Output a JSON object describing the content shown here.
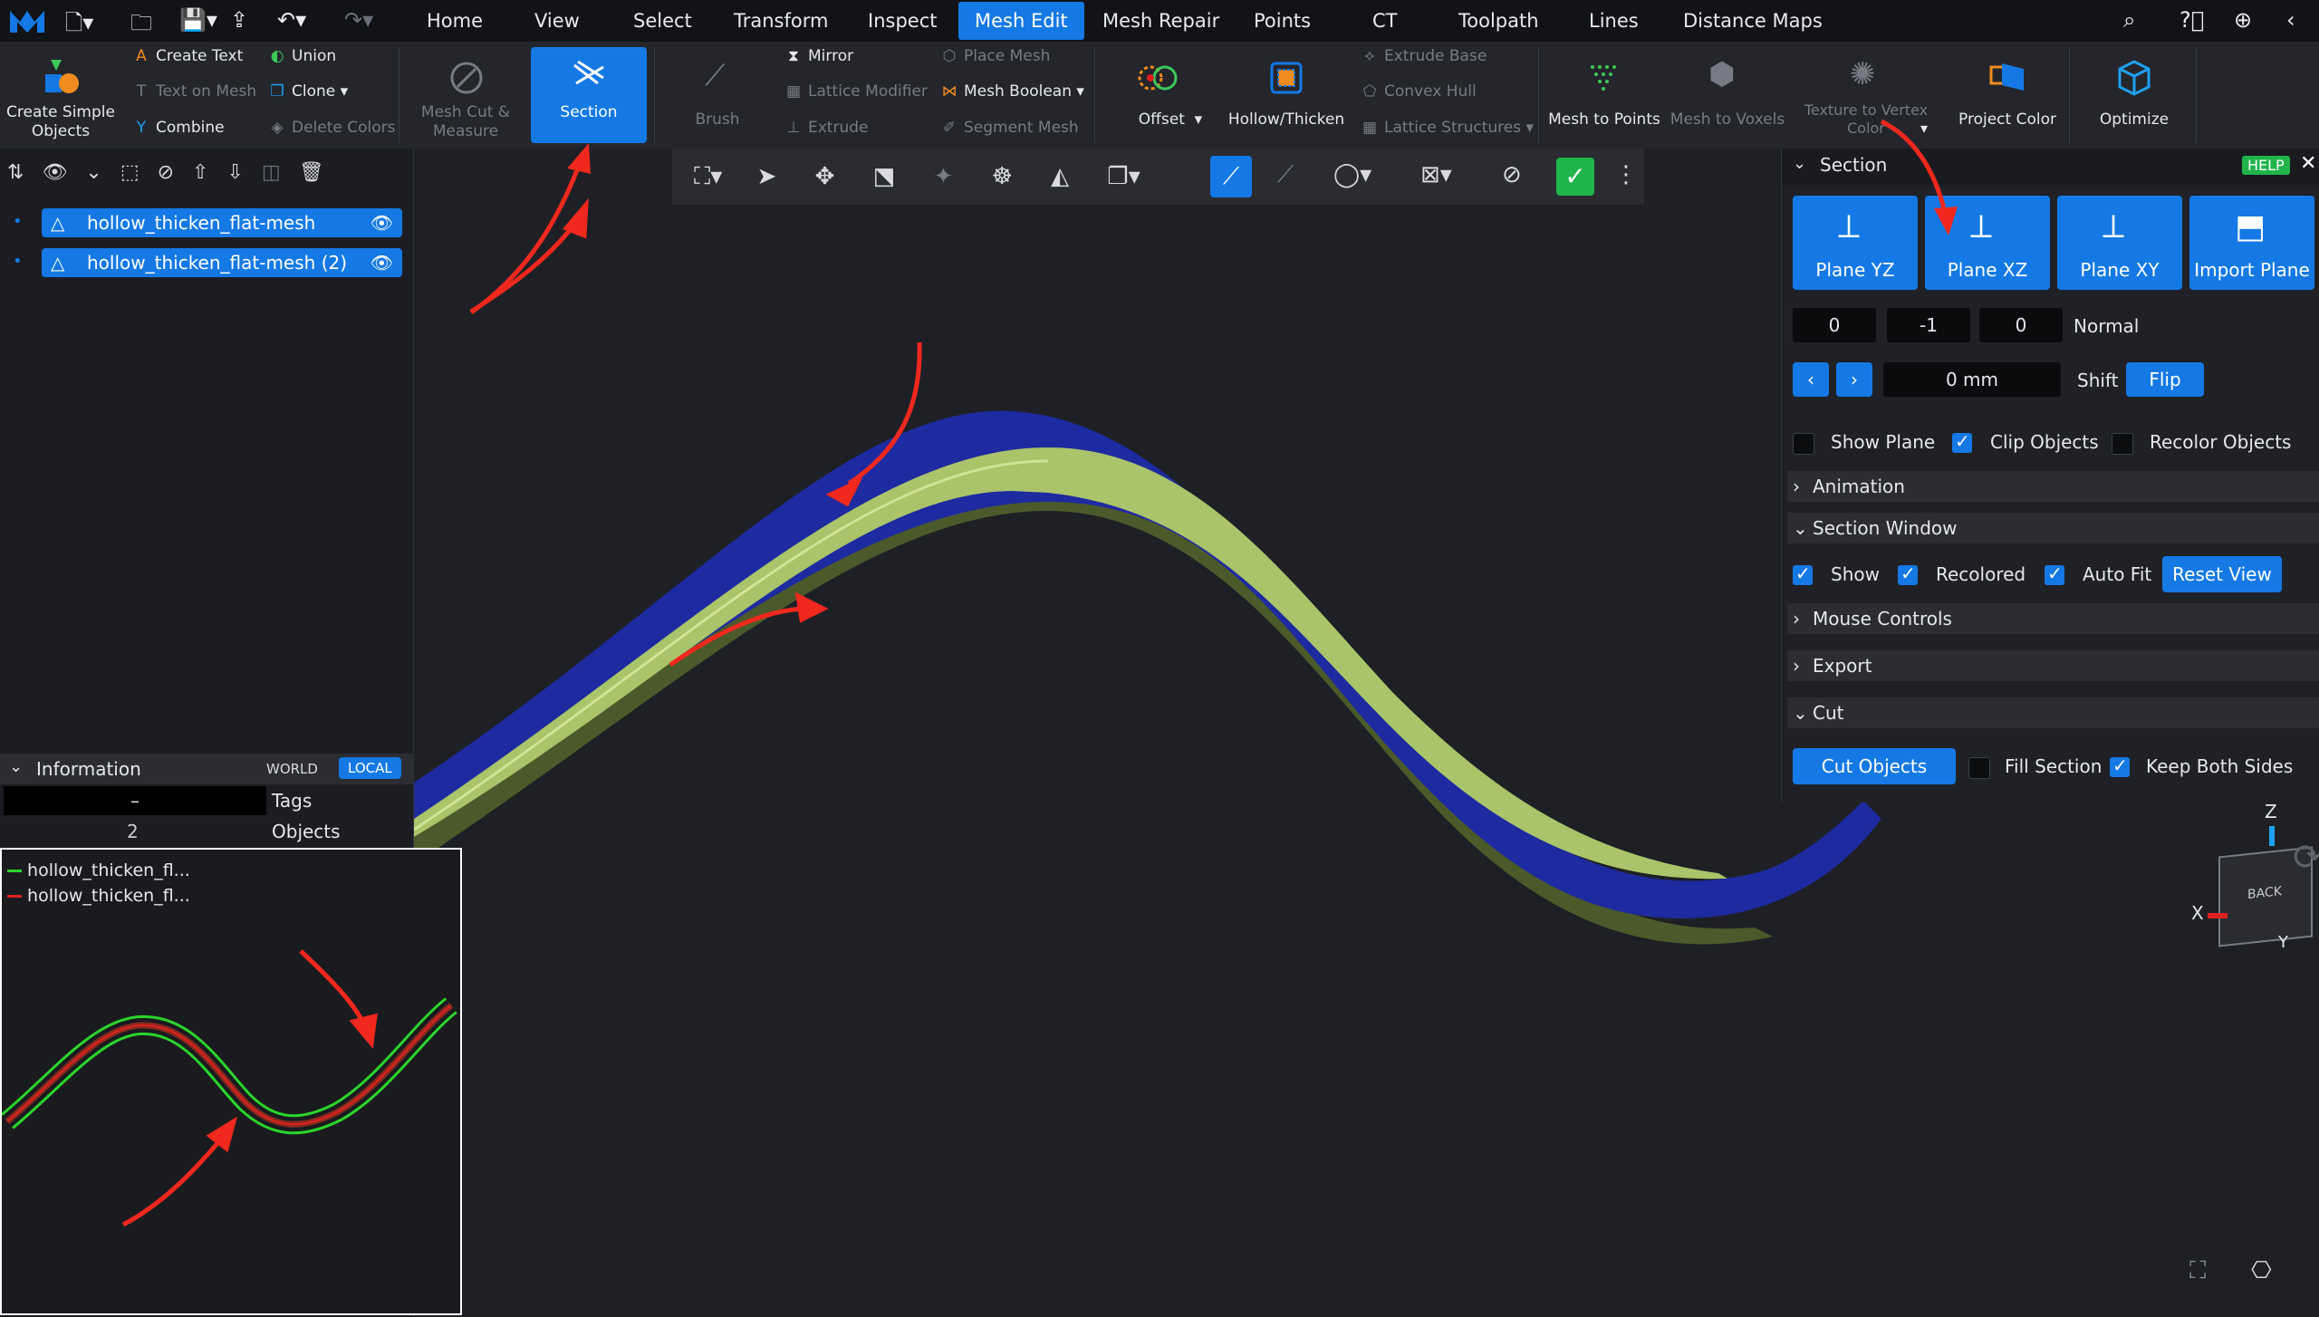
{
  "menubar": {
    "items": [
      "Home",
      "View",
      "Select",
      "Transform",
      "Inspect",
      "Mesh Edit",
      "Mesh Repair",
      "Points",
      "CT",
      "Toolpath",
      "Lines",
      "Distance Maps"
    ],
    "active": "Mesh Edit"
  },
  "ribbon": {
    "create_simple_objects": "Create Simple Objects",
    "create_text": "Create Text",
    "text_on_mesh": "Text on Mesh",
    "combine": "Combine",
    "union": "Union",
    "clone": "Clone",
    "delete_colors": "Delete Colors",
    "mesh_cut_measure": "Mesh Cut & Measure",
    "section": "Section",
    "brush": "Brush",
    "mirror": "Mirror",
    "lattice_modifier": "Lattice Modifier",
    "extrude": "Extrude",
    "place_mesh": "Place Mesh",
    "mesh_boolean": "Mesh Boolean",
    "segment_mesh": "Segment Mesh",
    "offset": "Offset",
    "hollow_thicken": "Hollow/Thicken",
    "extrude_base": "Extrude Base",
    "convex_hull": "Convex Hull",
    "lattice_structures": "Lattice Structures",
    "mesh_to_points": "Mesh to Points",
    "mesh_to_voxels": "Mesh to Voxels",
    "texture_to_vertex": "Texture to Vertex Color",
    "project_color": "Project Color",
    "optimize": "Optimize"
  },
  "scene_tree": {
    "items": [
      "hollow_thicken_flat-mesh",
      "hollow_thicken_flat-mesh (2)"
    ]
  },
  "info": {
    "title": "Information",
    "world": "WORLD",
    "local": "LOCAL",
    "tags_value": "–",
    "tags_label": "Tags",
    "objects_value": "2",
    "objects_label": "Objects"
  },
  "section_window": {
    "legend": [
      "hollow_thicken_fl...",
      "hollow_thicken_fl..."
    ],
    "legend_colors": [
      "#2bd52b",
      "#e02020"
    ]
  },
  "section_panel": {
    "title": "Section",
    "help": "HELP",
    "planes": [
      "Plane YZ",
      "Plane XZ",
      "Plane XY",
      "Import Plane"
    ],
    "normal": [
      "0",
      "-1",
      "0"
    ],
    "normal_label": "Normal",
    "shift_value": "0 mm",
    "shift_label": "Shift",
    "flip": "Flip",
    "show_plane": "Show Plane",
    "clip_objects": "Clip Objects",
    "recolor_objects": "Recolor Objects",
    "animation": "Animation",
    "section_window": "Section Window",
    "sw_show": "Show",
    "sw_recolored": "Recolored",
    "sw_autofit": "Auto Fit",
    "reset_view": "Reset View",
    "mouse_controls": "Mouse Controls",
    "export": "Export",
    "cut": "Cut",
    "cut_objects": "Cut Objects",
    "fill_section": "Fill Section",
    "keep_both_sides": "Keep Both Sides",
    "checkbox_states": {
      "show_plane": false,
      "clip_objects": true,
      "recolor_objects": false,
      "sw_show": true,
      "sw_recolored": true,
      "sw_autofit": true,
      "fill_section": false,
      "keep_both_sides": true
    }
  },
  "gizmo": {
    "z": "Z",
    "x": "X",
    "y": "Y",
    "face": "BACK"
  },
  "colors": {
    "accent": "#1479e5",
    "mesh_blue": "#1e2aa0",
    "mesh_green": "#a9c46a",
    "arrow_red": "#f0281e"
  }
}
